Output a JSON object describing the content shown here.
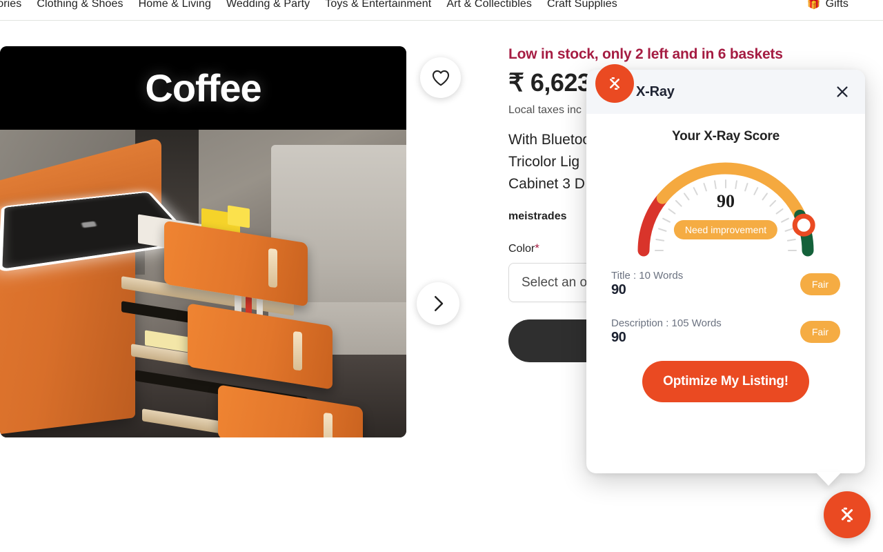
{
  "nav": {
    "items": [
      {
        "label": "ssories"
      },
      {
        "label": "Clothing & Shoes"
      },
      {
        "label": "Home & Living"
      },
      {
        "label": "Wedding & Party"
      },
      {
        "label": "Toys & Entertainment"
      },
      {
        "label": "Art & Collectibles"
      },
      {
        "label": "Craft Supplies"
      }
    ],
    "gifts_label": "Gifts",
    "gifts_icon": "gift-icon"
  },
  "gallery": {
    "banner_text": "Coffee",
    "favorite_icon": "heart-icon",
    "next_icon": "chevron-right-icon"
  },
  "product": {
    "stock_notice": "Low in stock, only 2 left and in 6 baskets",
    "price": "₹ 6,623",
    "taxes_note": "Local taxes inc",
    "description": "With Bluetoo\nTricolor Lig\nCabinet 3 D",
    "shop_name": "meistrades",
    "color_label": "Color",
    "color_required_mark": "*",
    "color_value": "Select an o",
    "add_to_cart_label": "",
    "secondary_line": ""
  },
  "xray": {
    "logo_icon": "xray-logo-icon",
    "title": "X-Ray",
    "close_icon": "close-icon",
    "score_heading": "Your X-Ray Score",
    "gauge": {
      "value": "90",
      "badge": "Need improvement",
      "min": 0,
      "max": 100,
      "needle_percent": 90,
      "colors": {
        "red": "#d9342b",
        "orange": "#f5a93f",
        "green": "#14613a",
        "marker": "#ea4a22"
      }
    },
    "metrics": [
      {
        "label": "Title : 10 Words",
        "score": "90",
        "rating": "Fair"
      },
      {
        "label": "Description : 105 Words",
        "score": "90",
        "rating": "Fair"
      }
    ],
    "optimize_label": "Optimize My Listing!",
    "accent_color": "#ea4a22",
    "pill_color": "#f5ac43"
  },
  "fab": {
    "icon": "xray-logo-icon"
  },
  "chart_data": {
    "type": "gauge",
    "title": "Your X-Ray Score",
    "value": 90,
    "min": 0,
    "max": 100,
    "label": "Need improvement",
    "bands": [
      {
        "name": "poor",
        "from": 0,
        "to": 22,
        "color": "#d9342b"
      },
      {
        "name": "fair",
        "from": 22,
        "to": 86,
        "color": "#f5a93f"
      },
      {
        "name": "good",
        "from": 86,
        "to": 100,
        "color": "#14613a"
      }
    ],
    "breakdown": {
      "categories": [
        "Title : 10 Words",
        "Description : 105 Words"
      ],
      "values": [
        90,
        90
      ],
      "ratings": [
        "Fair",
        "Fair"
      ]
    }
  }
}
